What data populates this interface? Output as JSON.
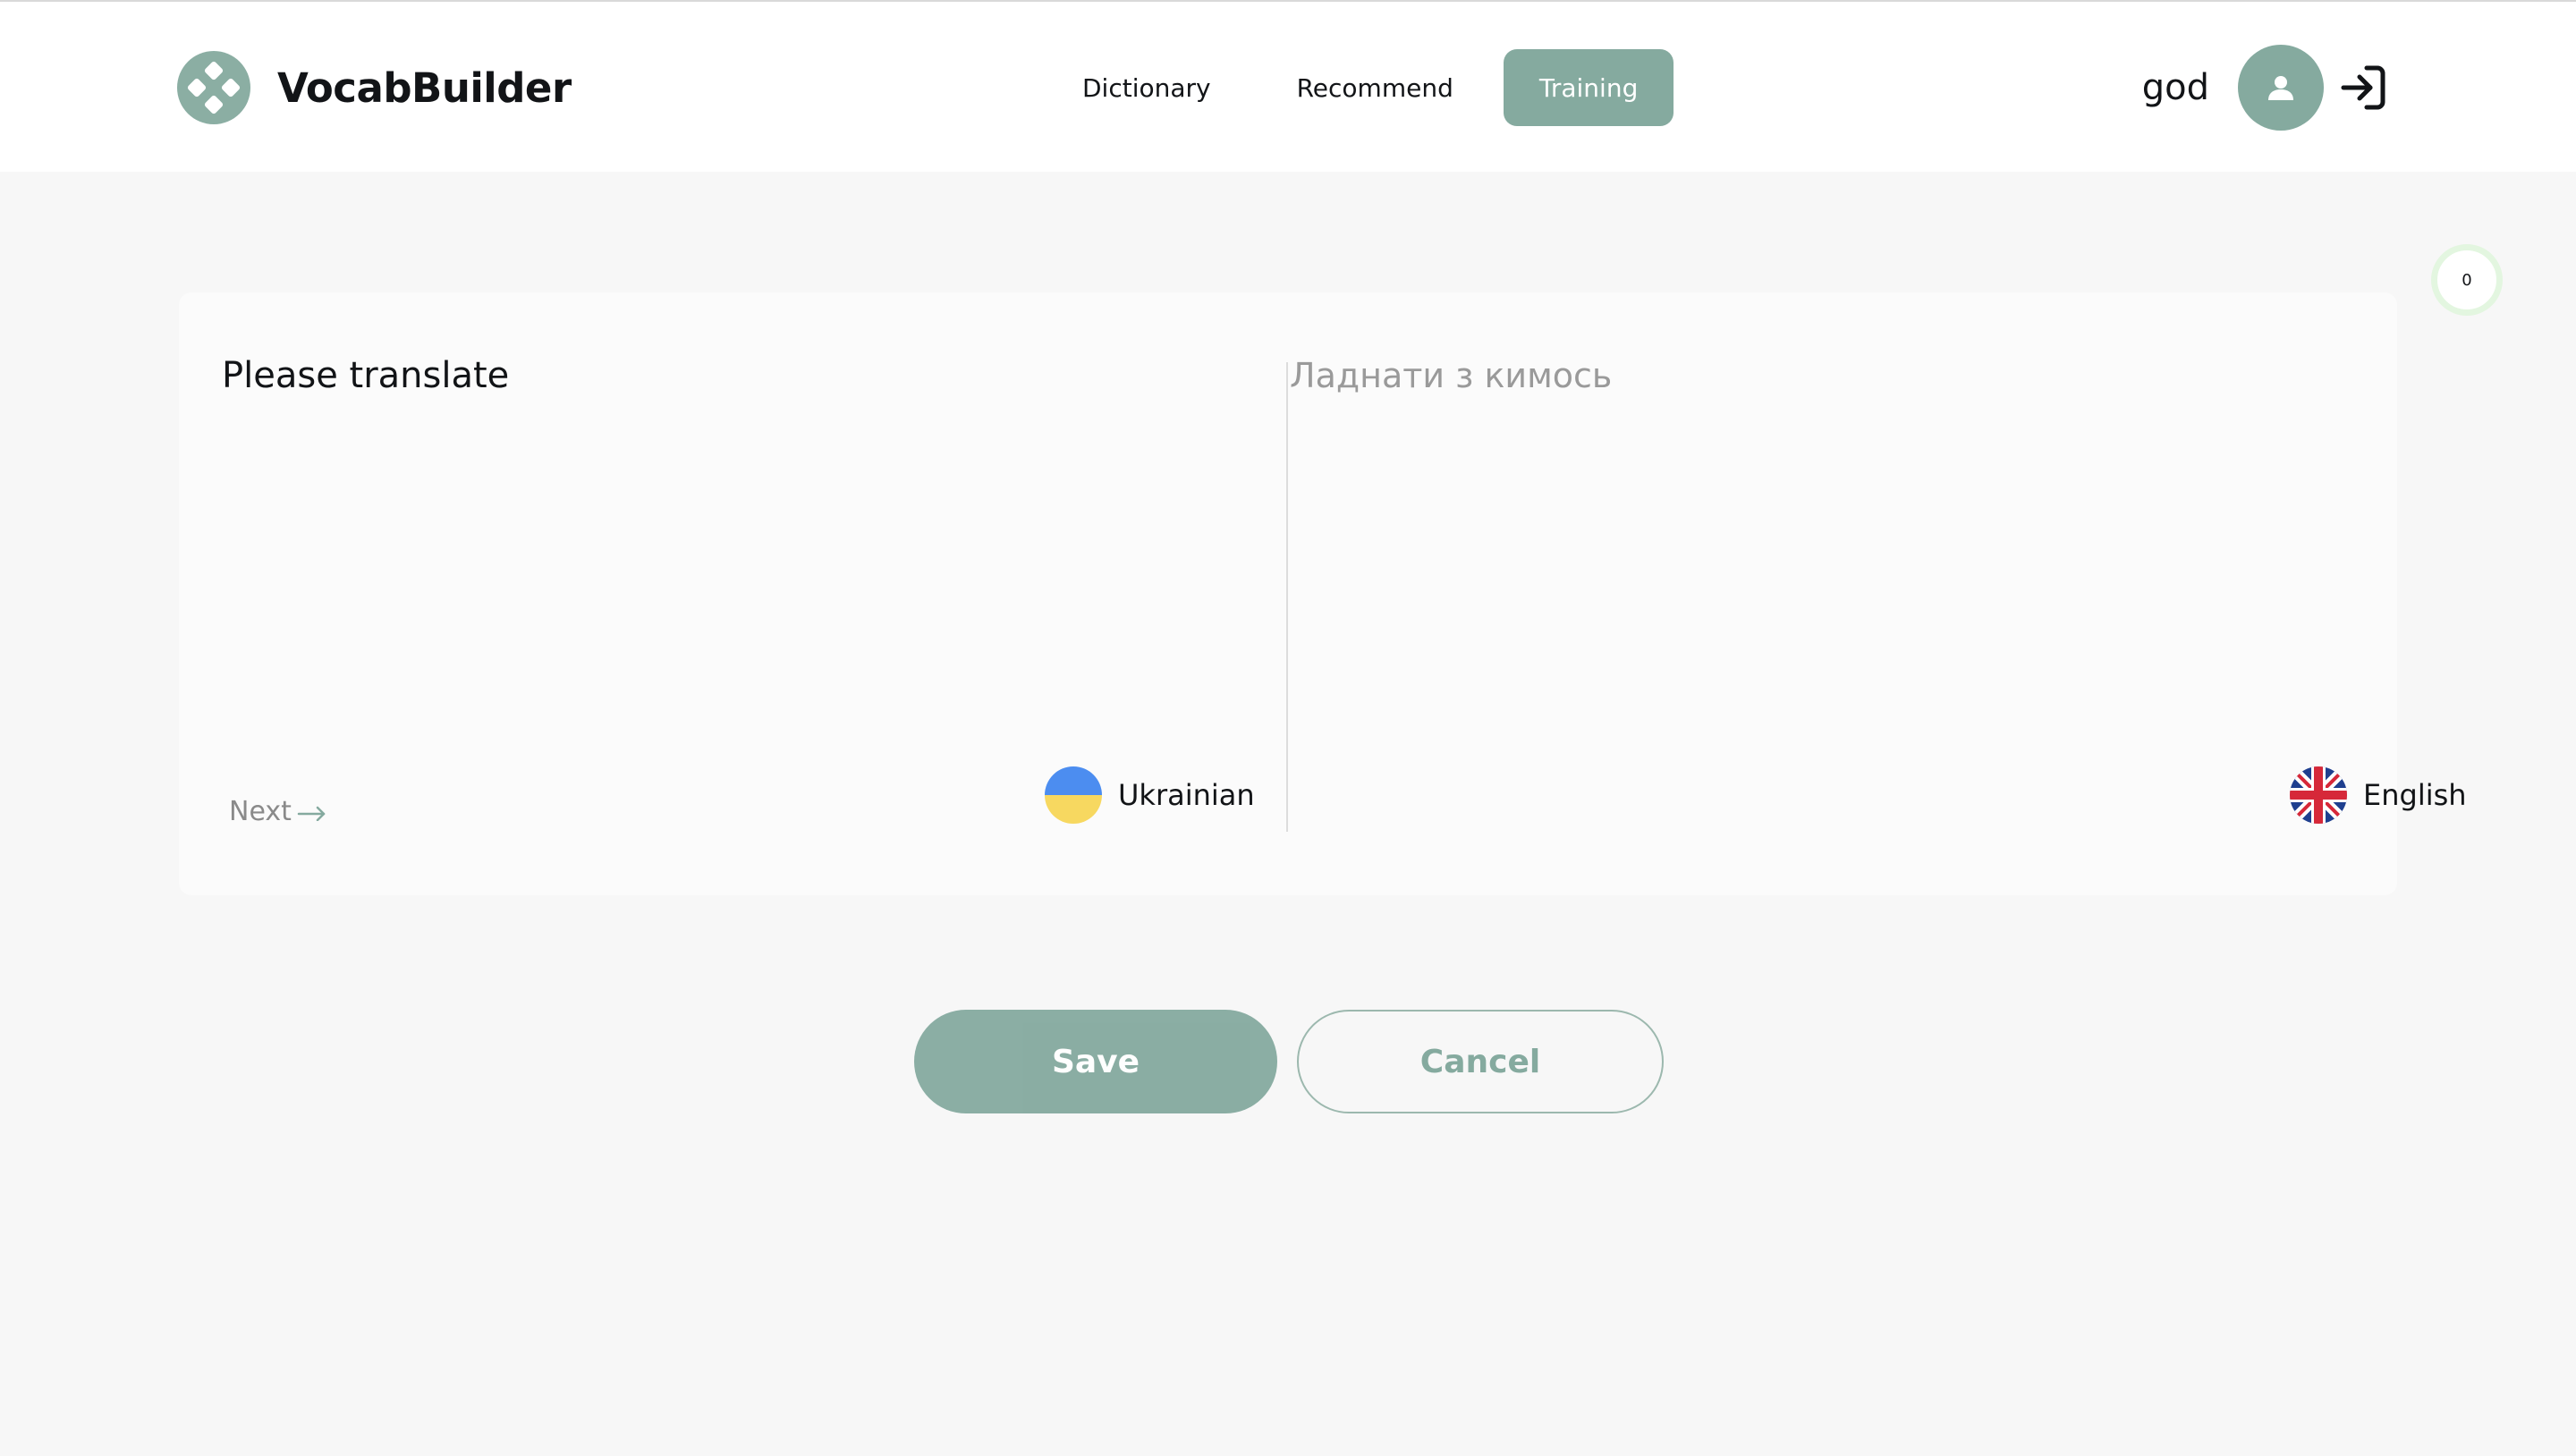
{
  "app": {
    "name": "VocabBuilder",
    "logo_icon": "clover-logo-icon",
    "accent_color": "#85AA9F"
  },
  "nav": {
    "items": [
      {
        "label": "Dictionary",
        "active": false
      },
      {
        "label": "Recommend",
        "active": false
      },
      {
        "label": "Training",
        "active": true
      }
    ]
  },
  "user": {
    "name": "god",
    "avatar_icon": "user-icon",
    "logout_icon": "logout-arrow-icon"
  },
  "progress": {
    "value": "0",
    "color": "#E3F6E0"
  },
  "training": {
    "prompt": "Please translate",
    "answer_placeholder": "Ладнати з кимось",
    "answer_value": "",
    "next_label": "Next",
    "source_language": {
      "label": "Ukrainian",
      "flag_icon": "ukraine-flag-icon"
    },
    "target_language": {
      "label": "English",
      "flag_icon": "uk-flag-icon"
    }
  },
  "actions": {
    "save_label": "Save",
    "cancel_label": "Cancel"
  }
}
